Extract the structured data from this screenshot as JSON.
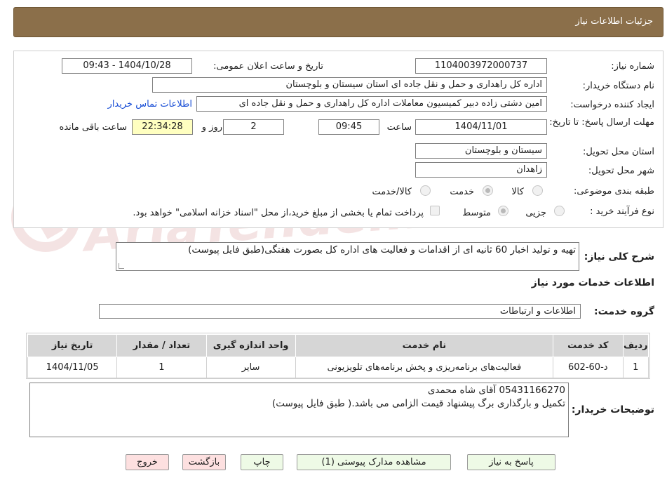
{
  "header": {
    "title": "جزئیات اطلاعات نیاز"
  },
  "form": {
    "need_number_label": "شماره نیاز:",
    "need_number": "1104003972000737",
    "announce_label": "تاریخ و ساعت اعلان عمومی:",
    "announce_value": "1404/10/28 - 09:43",
    "buyer_org_label": "نام دستگاه خریدار:",
    "buyer_org": "اداره کل راهداری و حمل و نقل جاده ای استان سیستان و بلوچستان",
    "requester_label": "ایجاد کننده درخواست:",
    "requester": "امین دشتی زاده دبیر کمیسیون معاملات اداره کل راهداری و حمل و نقل جاده ای",
    "contact_link": "اطلاعات تماس خریدار",
    "deadline_label": "مهلت ارسال پاسخ: تا تاریخ:",
    "deadline_date": "1404/11/01",
    "time_label": "ساعت",
    "deadline_time": "09:45",
    "days_value": "2",
    "days_label": "روز و",
    "remaining_time": "22:34:28",
    "remaining_label": "ساعت باقی مانده",
    "province_label": "استان محل تحویل:",
    "province": "سیستان و بلوچستان",
    "city_label": "شهر محل تحویل:",
    "city": "زاهدان",
    "category_label": "طبقه بندی موضوعی:",
    "category_options": [
      "کالا",
      "خدمت",
      "کالا/خدمت"
    ],
    "category_selected": "خدمت",
    "process_label": "نوع فرآیند خرید :",
    "process_options": [
      "جزیی",
      "متوسط"
    ],
    "process_selected": "متوسط",
    "payment_note": "پرداخت تمام یا بخشی از مبلغ خرید،از محل \"اسناد خزانه اسلامی\" خواهد بود."
  },
  "summary": {
    "label": "شرح کلی نیاز:",
    "text": "تهیه و تولید اخبار 60 ثانیه ای از اقدامات و فعالیت های اداره کل بصورت هفتگی(طبق فایل پیوست)"
  },
  "services": {
    "section_title": "اطلاعات خدمات مورد نیاز",
    "group_label": "گروه خدمت:",
    "group_value": "اطلاعات و ارتباطات",
    "columns": [
      "ردیف",
      "کد خدمت",
      "نام خدمت",
      "واحد اندازه گیری",
      "تعداد / مقدار",
      "تاریخ نیاز"
    ],
    "rows": [
      [
        "1",
        "د-60-602",
        "فعالیت‌های برنامه‌ریزی و پخش برنامه‌های تلویزیونی",
        "سایر",
        "1",
        "1404/11/05"
      ]
    ]
  },
  "buyer_notes": {
    "label": "توضیحات خریدار:",
    "line1": "05431166270 آقای شاه محمدی",
    "line2": "تکمیل و بارگذاری برگ پیشنهاد قیمت الزامی می باشد.( طبق فایل پیوست)"
  },
  "buttons": {
    "reply": "پاسخ به نیاز",
    "attachments": "مشاهده مدارک پیوستی (1)",
    "print": "چاپ",
    "back": "بازگشت",
    "exit": "خروج"
  },
  "watermark": {
    "text": "AriaTender.neT"
  },
  "colors": {
    "header_bg": "#8b6f4a",
    "link": "#1a4fd6",
    "button_green": "#eefae6",
    "button_pink": "#fde0e0",
    "highlight": "#ffffc0"
  }
}
